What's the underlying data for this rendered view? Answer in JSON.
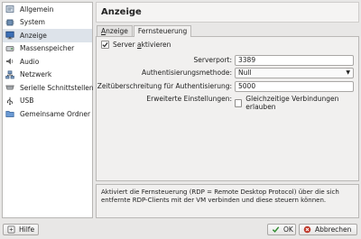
{
  "sidebar": {
    "items": [
      {
        "label": "Allgemein",
        "icon": "general-settings-icon"
      },
      {
        "label": "System",
        "icon": "system-chip-icon"
      },
      {
        "label": "Anzeige",
        "icon": "display-monitor-icon"
      },
      {
        "label": "Massenspeicher",
        "icon": "storage-disk-icon"
      },
      {
        "label": "Audio",
        "icon": "audio-speaker-icon"
      },
      {
        "label": "Netzwerk",
        "icon": "network-icon"
      },
      {
        "label": "Serielle Schnittstellen",
        "icon": "serial-port-icon"
      },
      {
        "label": "USB",
        "icon": "usb-icon"
      },
      {
        "label": "Gemeinsame Ordner",
        "icon": "shared-folder-icon"
      }
    ],
    "selected_index": 2
  },
  "header": {
    "title": "Anzeige"
  },
  "tabs": [
    {
      "label": "Anzeige",
      "accel": "A",
      "rest": "nzeige"
    },
    {
      "label": "Fernsteuerung",
      "accel": "",
      "rest": "Fernsteuerung"
    }
  ],
  "remote": {
    "server_enable_label": "Server aktivieren",
    "server_enable_pre": "Server ",
    "server_enable_accel": "a",
    "server_enable_post": "ktivieren",
    "server_enabled": true,
    "port_label": "Serverport:",
    "port_value": "3389",
    "auth_method_label": "Authentisierungsmethode:",
    "auth_method_value": "Null",
    "auth_timeout_label": "Zeitüberschreitung für Authentisierung:",
    "auth_timeout_value": "5000",
    "extended_label": "Erweiterte Einstellungen:",
    "multi_conn_label": "Gleichzeitige Verbindungen erlauben",
    "multi_conn_enabled": false
  },
  "info_text": "Aktiviert die Fernsteuerung (RDP = Remote Desktop Protocol) über die sich entfernte RDP-Clients mit der VM verbinden und diese steuern können.",
  "buttons": {
    "help": "Hilfe",
    "ok": "OK",
    "cancel": "Abbrechen"
  },
  "colors": {
    "selection": "#dde3ea",
    "ok_green": "#2e8b2e",
    "cancel_red": "#c0392b"
  }
}
